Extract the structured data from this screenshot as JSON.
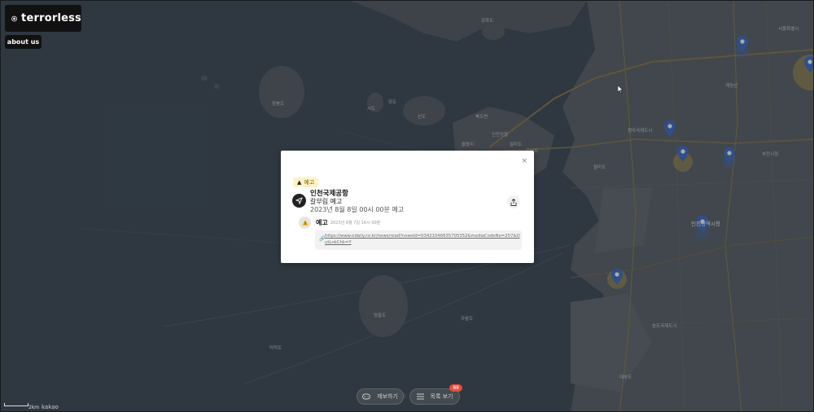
{
  "brand": {
    "name": "terrorless"
  },
  "nav": {
    "about_label": "about us"
  },
  "map": {
    "attribution": "kakao",
    "scale_label": "2km",
    "colors": {
      "water": "#3d4a52",
      "land": "#5a6266",
      "road": "#8a7a4a",
      "pin": "#3e6fc4",
      "pin_glow": "#c9a640"
    },
    "labels": [
      "인천광역시청",
      "부천시청",
      "장봉도",
      "영흥도",
      "신도",
      "시도",
      "모도",
      "북도면",
      "을왕리",
      "무의도",
      "실미도",
      "월미도",
      "강화도",
      "대부도",
      "자월도",
      "덕적도",
      "인천공항",
      "청라국제도시",
      "송도국제도시",
      "계양산",
      "서울특별시"
    ]
  },
  "bottom_bar": {
    "report_label": "제보하기",
    "list_label": "목록 보기",
    "list_count": "88"
  },
  "modal": {
    "close_label": "×",
    "tag_label": "예고",
    "place_name": "인천국제공항",
    "threat_type": "칼부림 예고",
    "schedule": "2023년 8월 8일 00시 00분 예고",
    "report": {
      "type": "예고",
      "time": "2023년 8월 7일 16시 00분",
      "link": "https://www.edaily.co.kr/news/read?newsId=03421046635705352&mediaCodeNo=257&OutLnkChk=Y"
    }
  }
}
